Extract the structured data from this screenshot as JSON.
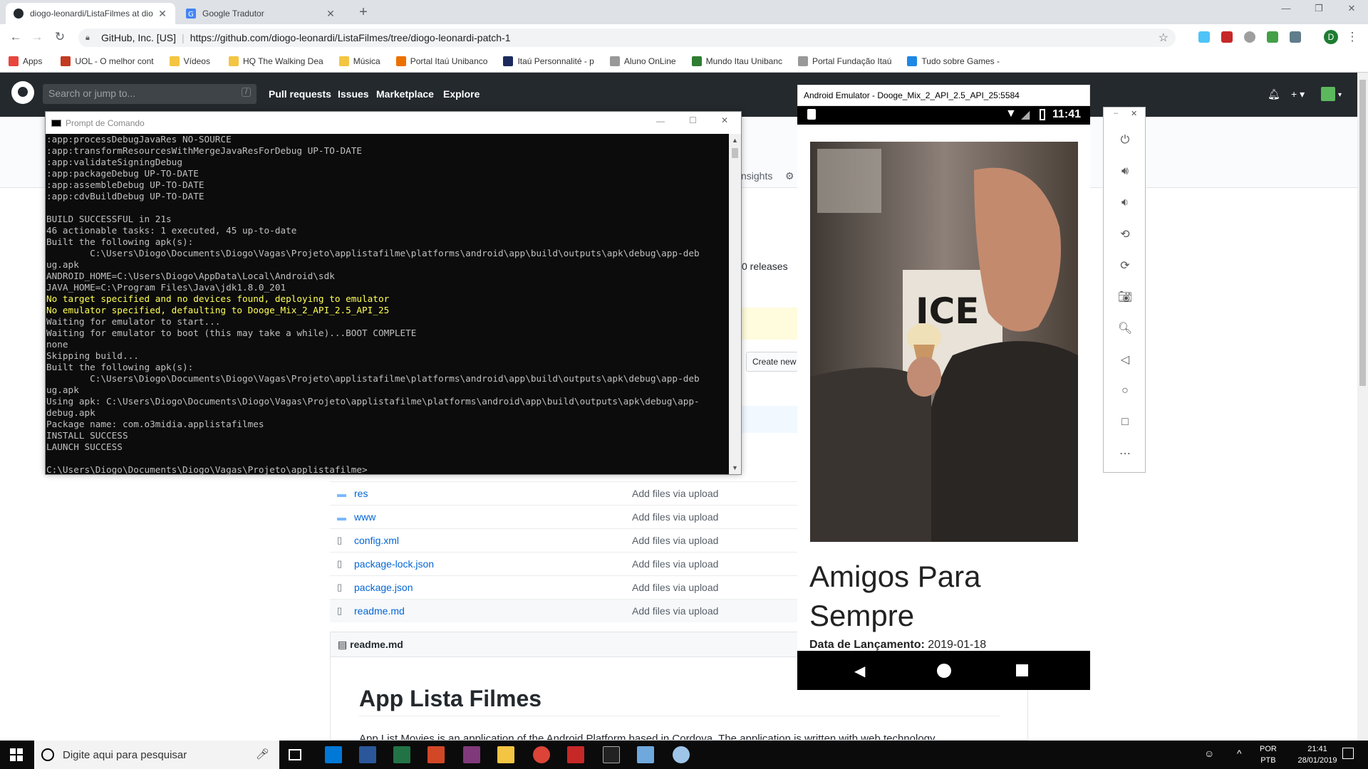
{
  "browser": {
    "tabs": [
      {
        "title": "diogo-leonardi/ListaFilmes at dio",
        "active": true
      },
      {
        "title": "Google Tradutor",
        "active": false
      }
    ],
    "new_tab": "+",
    "window": {
      "minimize": "—",
      "restore": "❐",
      "close": "✕"
    },
    "security_label": "GitHub, Inc. [US]",
    "url": "https://github.com/diogo-leonardi/ListaFilmes/tree/diogo-leonardi-patch-1",
    "profile_letter": "D"
  },
  "bookmarks": [
    {
      "label": "Apps",
      "color": "#e8453c"
    },
    {
      "label": "UOL - O melhor cont",
      "color": "#c23b22"
    },
    {
      "label": "Vídeos",
      "color": "#f4c542"
    },
    {
      "label": "HQ The Walking Dea",
      "color": "#f4c542"
    },
    {
      "label": "Música",
      "color": "#f4c542"
    },
    {
      "label": "Portal Itaú Unibanco",
      "color": "#ec7000"
    },
    {
      "label": "Itaú Personnalité - p",
      "color": "#1b2a5c"
    },
    {
      "label": "Aluno OnLine",
      "color": "#999999"
    },
    {
      "label": "Mundo Itau Unibanc",
      "color": "#2e7d32"
    },
    {
      "label": "Portal Fundação Itaú",
      "color": "#999999"
    },
    {
      "label": "Tudo sobre Games -",
      "color": "#1e88e5"
    }
  ],
  "github": {
    "search_placeholder": "Search or jump to...",
    "search_shortcut": "/",
    "nav": [
      "Pull requests",
      "Issues",
      "Marketplace",
      "Explore"
    ],
    "insights_label": "nsights",
    "releases": "0 releases",
    "create_new": "Create new",
    "files": [
      {
        "name": "res",
        "type": "folder",
        "message": "Add files via upload"
      },
      {
        "name": "www",
        "type": "folder",
        "message": "Add files via upload"
      },
      {
        "name": "config.xml",
        "type": "file",
        "message": "Add files via upload"
      },
      {
        "name": "package-lock.json",
        "type": "file",
        "message": "Add files via upload"
      },
      {
        "name": "package.json",
        "type": "file",
        "message": "Add files via upload"
      },
      {
        "name": "readme.md",
        "type": "file",
        "message": "Add files via upload"
      }
    ],
    "readme_header": "readme.md",
    "readme_title": "App Lista Filmes",
    "readme_text": "App List Movies is an application of the Android Platform based in Cordova. The application is written with web technology"
  },
  "cmd": {
    "title": "Prompt de Comando",
    "lines": [
      {
        "text": ":app:processDebugJavaRes NO-SOURCE",
        "hl": false
      },
      {
        "text": ":app:transformResourcesWithMergeJavaResForDebug UP-TO-DATE",
        "hl": false
      },
      {
        "text": ":app:validateSigningDebug",
        "hl": false
      },
      {
        "text": ":app:packageDebug UP-TO-DATE",
        "hl": false
      },
      {
        "text": ":app:assembleDebug UP-TO-DATE",
        "hl": false
      },
      {
        "text": ":app:cdvBuildDebug UP-TO-DATE",
        "hl": false
      },
      {
        "text": "",
        "hl": false
      },
      {
        "text": "BUILD SUCCESSFUL in 21s",
        "hl": false
      },
      {
        "text": "46 actionable tasks: 1 executed, 45 up-to-date",
        "hl": false
      },
      {
        "text": "Built the following apk(s):",
        "hl": false
      },
      {
        "text": "        C:\\Users\\Diogo\\Documents\\Diogo\\Vagas\\Projeto\\applistafilme\\platforms\\android\\app\\build\\outputs\\apk\\debug\\app-deb",
        "hl": false
      },
      {
        "text": "ug.apk",
        "hl": false
      },
      {
        "text": "ANDROID_HOME=C:\\Users\\Diogo\\AppData\\Local\\Android\\sdk",
        "hl": false
      },
      {
        "text": "JAVA_HOME=C:\\Program Files\\Java\\jdk1.8.0_201",
        "hl": false
      },
      {
        "text": "No target specified and no devices found, deploying to emulator",
        "hl": true
      },
      {
        "text": "No emulator specified, defaulting to Dooge_Mix_2_API_2.5_API_25",
        "hl": true
      },
      {
        "text": "Waiting for emulator to start...",
        "hl": false
      },
      {
        "text": "Waiting for emulator to boot (this may take a while)...BOOT COMPLETE",
        "hl": false
      },
      {
        "text": "none",
        "hl": false
      },
      {
        "text": "Skipping build...",
        "hl": false
      },
      {
        "text": "Built the following apk(s):",
        "hl": false
      },
      {
        "text": "        C:\\Users\\Diogo\\Documents\\Diogo\\Vagas\\Projeto\\applistafilme\\platforms\\android\\app\\build\\outputs\\apk\\debug\\app-deb",
        "hl": false
      },
      {
        "text": "ug.apk",
        "hl": false
      },
      {
        "text": "Using apk: C:\\Users\\Diogo\\Documents\\Diogo\\Vagas\\Projeto\\applistafilme\\platforms\\android\\app\\build\\outputs\\apk\\debug\\app-",
        "hl": false
      },
      {
        "text": "debug.apk",
        "hl": false
      },
      {
        "text": "Package name: com.o3midia.applistafilmes",
        "hl": false
      },
      {
        "text": "INSTALL SUCCESS",
        "hl": false
      },
      {
        "text": "LAUNCH SUCCESS",
        "hl": false
      },
      {
        "text": "",
        "hl": false
      },
      {
        "text": "C:\\Users\\Diogo\\Documents\\Diogo\\Vagas\\Projeto\\applistafilme>",
        "hl": false
      }
    ]
  },
  "emulator": {
    "title": "Android Emulator - Dooge_Mix_2_API_2.5_API_25:5584",
    "time": "11:41",
    "movie_title": "Amigos Para Sempre",
    "release_label": "Data de Lançamento:",
    "release_date": "2019-01-18",
    "side_controls": [
      "power-icon",
      "volume-up-icon",
      "volume-down-icon",
      "rotate-left-icon",
      "rotate-right-icon",
      "camera-icon",
      "zoom-icon",
      "back-icon",
      "home-icon",
      "overview-icon",
      "more-icon"
    ]
  },
  "taskbar": {
    "search_placeholder": "Digite aqui para pesquisar",
    "lang_top": "POR",
    "lang_bottom": "PTB",
    "time": "21:41",
    "date": "28/01/2019"
  },
  "colors": {
    "github_header": "#24292e",
    "link": "#0366d6",
    "terminal_yellow": "#ffff55"
  }
}
